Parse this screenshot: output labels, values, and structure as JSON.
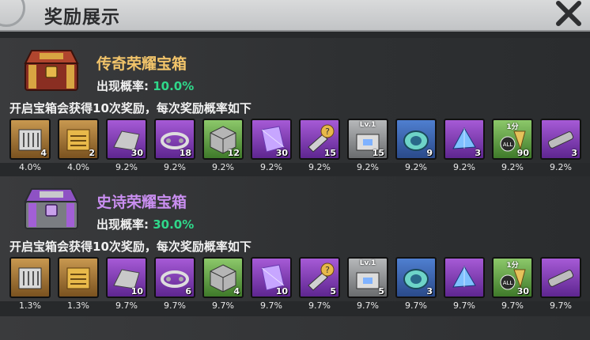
{
  "title": "奖励展示",
  "icons": {
    "close": "close-x-icon"
  },
  "sections": [
    {
      "name": "传奇荣耀宝箱",
      "name_color": "#f2c46a",
      "rate_label": "出现概率:",
      "rate_value": "10.0%",
      "note": "开启宝箱会获得10次奖励，每次奖励概率如下",
      "items": [
        {
          "icon": "parts-crate-icon",
          "rarity": "gold",
          "qty": "4",
          "pct": "4.0%",
          "tag": ""
        },
        {
          "icon": "gold-parts-crate-icon",
          "rarity": "gold",
          "qty": "2",
          "pct": "4.0%",
          "tag": ""
        },
        {
          "icon": "armor-plate-icon",
          "rarity": "purple",
          "qty": "30",
          "pct": "9.2%",
          "tag": ""
        },
        {
          "icon": "tank-track-icon",
          "rarity": "purple",
          "qty": "18",
          "pct": "9.2%",
          "tag": ""
        },
        {
          "icon": "metal-cube-icon",
          "rarity": "green",
          "qty": "12",
          "pct": "9.2%",
          "tag": ""
        },
        {
          "icon": "crystal-shard-icon",
          "rarity": "purple",
          "qty": "30",
          "pct": "9.2%",
          "tag": ""
        },
        {
          "icon": "mystery-drill-icon",
          "rarity": "purple",
          "qty": "15",
          "pct": "9.2%",
          "tag": ""
        },
        {
          "icon": "lv1-upgrade-kit-icon",
          "rarity": "grey",
          "qty": "15",
          "pct": "9.2%",
          "tag": "Lv.1"
        },
        {
          "icon": "energy-core-icon",
          "rarity": "blue",
          "qty": "9",
          "pct": "9.2%",
          "tag": ""
        },
        {
          "icon": "blue-shard-icon",
          "rarity": "purple",
          "qty": "3",
          "pct": "9.2%",
          "tag": ""
        },
        {
          "icon": "speedup-all-icon",
          "rarity": "green",
          "qty": "90",
          "pct": "9.2%",
          "tag": "1分"
        },
        {
          "icon": "cannon-barrel-icon",
          "rarity": "purple",
          "qty": "3",
          "pct": "9.2%",
          "tag": ""
        }
      ]
    },
    {
      "name": "史诗荣耀宝箱",
      "name_color": "#c98ef0",
      "rate_label": "出现概率:",
      "rate_value": "30.0%",
      "note": "开启宝箱会获得10次奖励，每次奖励概率如下",
      "items": [
        {
          "icon": "parts-crate-icon",
          "rarity": "gold",
          "qty": "",
          "pct": "1.3%",
          "tag": ""
        },
        {
          "icon": "gold-parts-crate-icon",
          "rarity": "gold",
          "qty": "",
          "pct": "1.3%",
          "tag": ""
        },
        {
          "icon": "armor-plate-icon",
          "rarity": "purple",
          "qty": "10",
          "pct": "9.7%",
          "tag": ""
        },
        {
          "icon": "tank-track-icon",
          "rarity": "purple",
          "qty": "6",
          "pct": "9.7%",
          "tag": ""
        },
        {
          "icon": "metal-cube-icon",
          "rarity": "green",
          "qty": "4",
          "pct": "9.7%",
          "tag": ""
        },
        {
          "icon": "crystal-shard-icon",
          "rarity": "purple",
          "qty": "10",
          "pct": "9.7%",
          "tag": ""
        },
        {
          "icon": "mystery-drill-icon",
          "rarity": "purple",
          "qty": "5",
          "pct": "9.7%",
          "tag": ""
        },
        {
          "icon": "lv1-upgrade-kit-icon",
          "rarity": "grey",
          "qty": "5",
          "pct": "9.7%",
          "tag": "Lv.1"
        },
        {
          "icon": "energy-core-icon",
          "rarity": "blue",
          "qty": "3",
          "pct": "9.7%",
          "tag": ""
        },
        {
          "icon": "blue-shard-icon",
          "rarity": "purple",
          "qty": "",
          "pct": "9.7%",
          "tag": ""
        },
        {
          "icon": "speedup-all-icon",
          "rarity": "green",
          "qty": "30",
          "pct": "9.7%",
          "tag": "1分"
        },
        {
          "icon": "cannon-barrel-icon",
          "rarity": "purple",
          "qty": "",
          "pct": "9.7%",
          "tag": ""
        }
      ]
    }
  ]
}
